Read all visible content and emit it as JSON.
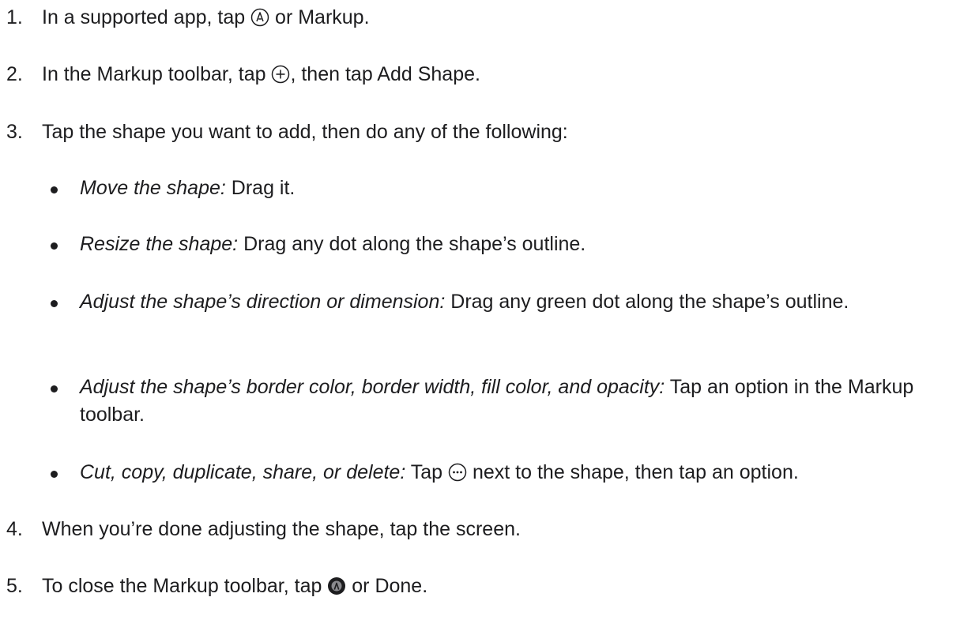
{
  "steps": [
    {
      "num": "1.",
      "before": "In a supported app, tap ",
      "icon": "markup-icon",
      "after": " or Markup."
    },
    {
      "num": "2.",
      "before": "In the Markup toolbar, tap ",
      "icon": "add-circle-icon",
      "after": ", then tap Add Shape."
    },
    {
      "num": "3.",
      "text": "Tap the shape you want to add, then do any of the following:"
    },
    {
      "num": "4.",
      "text": "When you’re done adjusting the shape, tap the screen."
    },
    {
      "num": "5.",
      "before": "To close the Markup toolbar, tap ",
      "icon": "markup-filled-icon",
      "after": " or Done."
    }
  ],
  "bullets": [
    {
      "em": "Move the shape:",
      "text": " Drag it."
    },
    {
      "em": "Resize the shape:",
      "text": " Drag any dot along the shape’s outline."
    },
    {
      "em": "Adjust the shape’s direction or dimension:",
      "text": " Drag any green dot along the shape’s outline."
    },
    {
      "em": "Adjust the shape’s border color, border width, fill color, and opacity:",
      "text": " Tap an option in the Markup toolbar."
    },
    {
      "em": "Cut, copy, duplicate, share, or delete:",
      "before": " Tap ",
      "icon": "more-icon",
      "after": " next to the shape, then tap an option."
    }
  ]
}
